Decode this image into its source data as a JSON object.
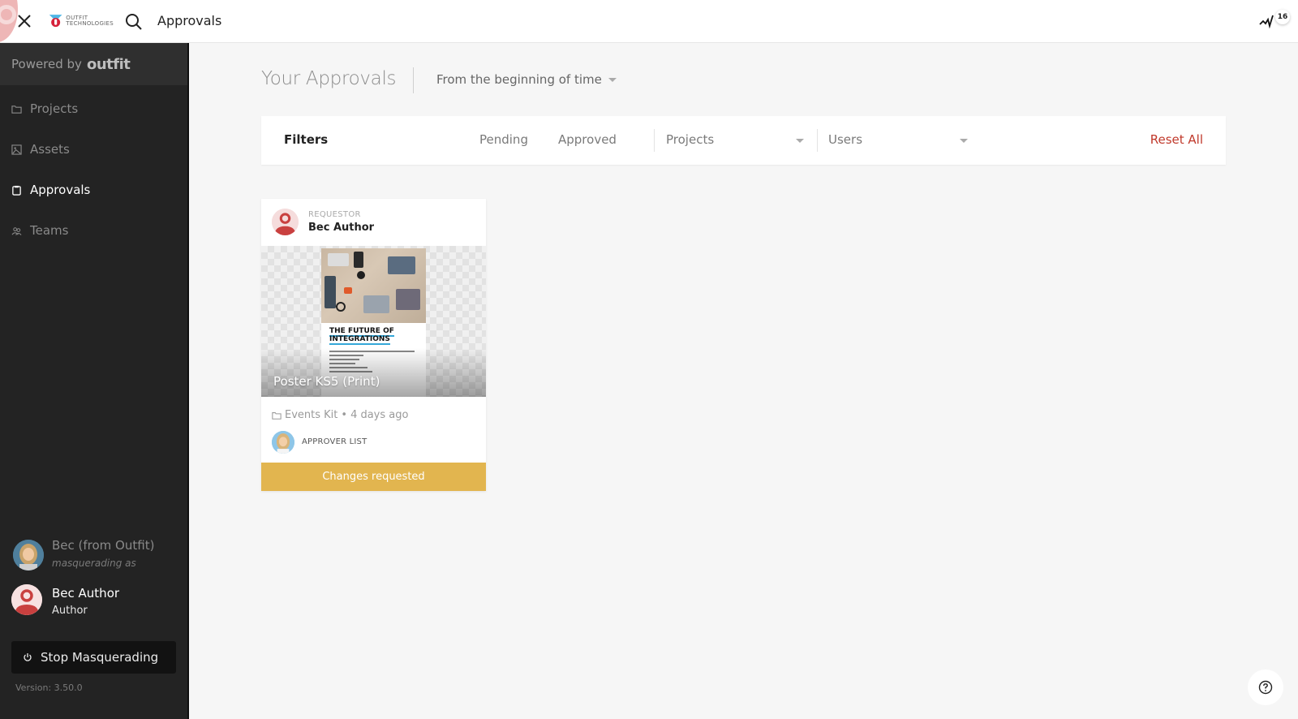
{
  "topbar": {
    "title": "Approvals",
    "logo_line1": "OUTFIT",
    "logo_line2": "TECHNOLOGIES",
    "activity_count": "16"
  },
  "sidebar": {
    "powered_by": "Powered by",
    "brand": "outfit",
    "nav": [
      {
        "label": "Projects",
        "icon": "folder-icon",
        "active": false
      },
      {
        "label": "Assets",
        "icon": "image-icon",
        "active": false
      },
      {
        "label": "Approvals",
        "icon": "clipboard-icon",
        "active": true
      },
      {
        "label": "Teams",
        "icon": "users-icon",
        "active": false
      }
    ],
    "masquerade": {
      "original_user": "Bec (from Outfit)",
      "masquerading_label": "masquerading as",
      "current_user": "Bec Author",
      "current_role": "Author"
    },
    "stop_button": "Stop Masquerading",
    "version": "Version: 3.50.0"
  },
  "main": {
    "heading": "Your Approvals",
    "time_filter": "From the beginning of time",
    "filters": {
      "label": "Filters",
      "pending": "Pending",
      "approved": "Approved",
      "projects": "Projects",
      "users": "Users",
      "reset": "Reset All"
    },
    "cards": [
      {
        "requestor_label": "REQUESTOR",
        "requestor_name": "Bec Author",
        "title": "Poster KS5 (Print)",
        "poster_heading_1": "THE FUTURE OF",
        "poster_heading_2": "INTEGRATIONS",
        "project": "Events Kit",
        "separator": "•",
        "age": "4 days ago",
        "approver_label": "APPROVER LIST",
        "status": "Changes requested",
        "status_color": "#e2b54f"
      }
    ]
  },
  "colors": {
    "sidebar_bg": "#232323",
    "accent_red": "#c0392b",
    "status_changes": "#e2b54f"
  }
}
